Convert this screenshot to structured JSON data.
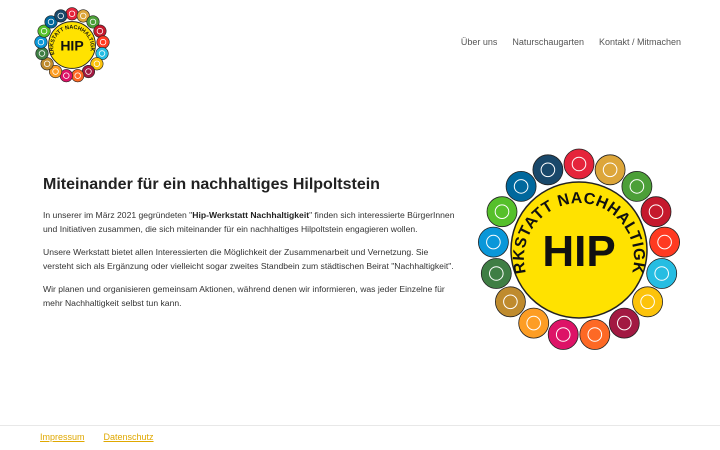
{
  "header": {
    "logo": {
      "center_text": "HIP",
      "ring_text": "WERKSTATT NACHHALTIGKEIT",
      "colors": {
        "yellow": "#ffe200",
        "outline": "#222222"
      }
    },
    "nav": [
      {
        "label": "Über uns"
      },
      {
        "label": "Naturschaugarten"
      },
      {
        "label": "Kontakt / Mitmachen"
      }
    ]
  },
  "main": {
    "title": "Miteinander für ein nachhaltiges Hilpoltstein",
    "p1_before": "In unserer im März 2021 gegründeten \"",
    "p1_bold": "Hip-Werkstatt Nachhaltigkeit",
    "p1_after": "\" finden sich interessierte BürgerInnen und Initiativen zusammen, die sich miteinander für ein nachhaltiges Hilpoltstein engagieren wollen.",
    "p2": "Unsere Werkstatt bietet allen Interessierten die Möglichkeit der Zusammenarbeit und Vernetzung. Sie versteht sich als Ergänzung oder vielleicht sogar zweites Standbein zum städtischen Beirat \"Nachhaltigkeit\".",
    "p3": "Wir planen und organisieren gemeinsam Aktionen, während denen wir informieren, was jeder Einzelne für mehr Nachhaltigkeit selbst tun kann."
  },
  "big_logo": {
    "center_text": "HIP",
    "ring_text": "WERKSTATT NACHHALTIGKEIT",
    "sdg_icon_colors": [
      "#e5243b",
      "#dda63a",
      "#4c9f38",
      "#c5192d",
      "#ff3a21",
      "#26bde2",
      "#fcc30b",
      "#a21942",
      "#fd6925",
      "#dd1367",
      "#fd9d24",
      "#bf8b2e",
      "#3f7e44",
      "#0a97d9",
      "#56c02b",
      "#00689d",
      "#19486a"
    ]
  },
  "footer": {
    "links": [
      {
        "label": "Impressum"
      },
      {
        "label": "Datenschutz"
      }
    ],
    "link_color": "#e0a800"
  }
}
